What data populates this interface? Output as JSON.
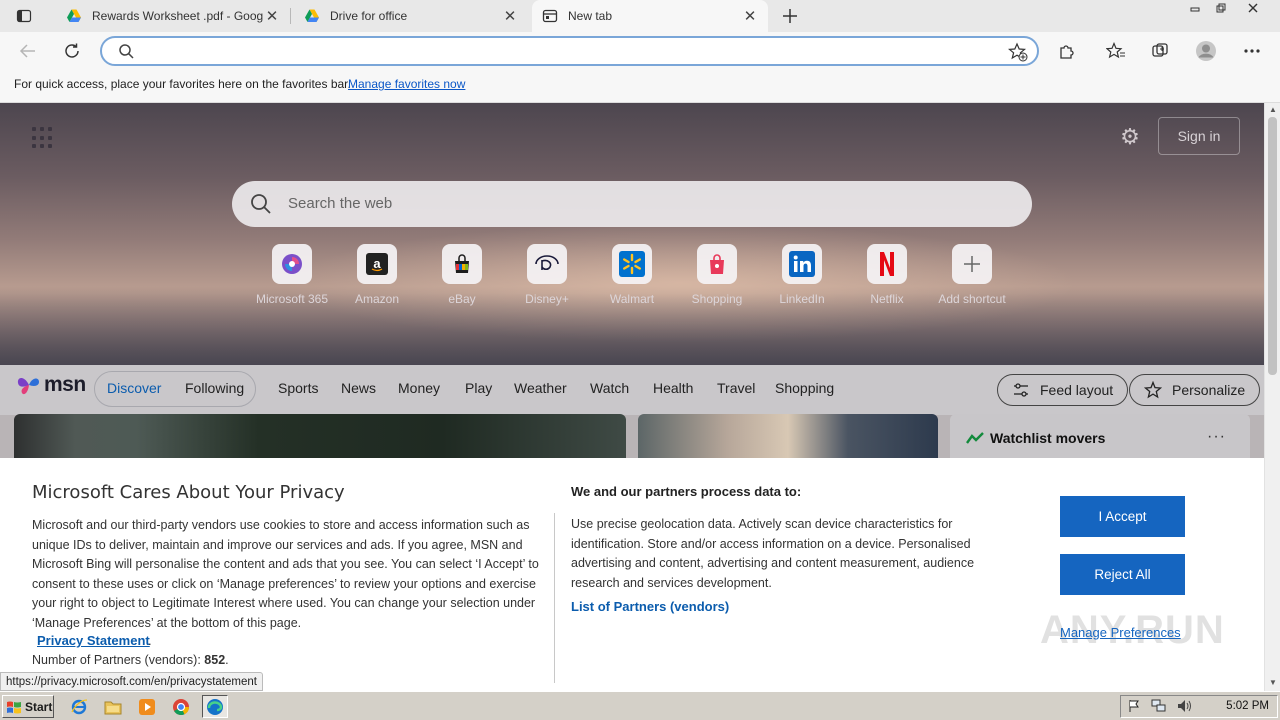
{
  "browser": {
    "tabs": [
      {
        "title": "Rewards Worksheet .pdf - Goog",
        "icon": "google-drive-icon"
      },
      {
        "title": "Drive for office",
        "icon": "google-drive-icon"
      },
      {
        "title": "New tab",
        "icon": "new-tab-icon"
      }
    ],
    "address_value": "",
    "favorites_bar": {
      "message": "For quick access, place your favorites here on the favorites bar.",
      "link": "Manage favorites now"
    }
  },
  "newtab": {
    "signin": "Sign in",
    "search_placeholder": "Search the web",
    "shortcuts": [
      {
        "label": "Microsoft 365",
        "icon": "microsoft365-icon"
      },
      {
        "label": "Amazon",
        "icon": "amazon-icon"
      },
      {
        "label": "eBay",
        "icon": "ebay-icon"
      },
      {
        "label": "Disney+",
        "icon": "disney-plus-icon"
      },
      {
        "label": "Walmart",
        "icon": "walmart-icon"
      },
      {
        "label": "Shopping",
        "icon": "shopping-bag-icon"
      },
      {
        "label": "LinkedIn",
        "icon": "linkedin-icon"
      },
      {
        "label": "Netflix",
        "icon": "netflix-icon"
      },
      {
        "label": "Add shortcut",
        "icon": "plus-icon"
      }
    ]
  },
  "msn": {
    "logo": "msn",
    "tabs": [
      "Discover",
      "Following"
    ],
    "nav": [
      "Sports",
      "News",
      "Money",
      "Play",
      "Weather",
      "Watch",
      "Health",
      "Travel",
      "Shopping"
    ],
    "feed_layout": "Feed layout",
    "personalize": "Personalize",
    "watchlist_title": "Watchlist movers",
    "more": "···"
  },
  "privacy": {
    "title": "Microsoft Cares About Your Privacy",
    "body": "Microsoft and our third-party vendors use cookies to store and access information such as unique IDs to deliver, maintain and improve our services and ads. If you agree, MSN and Microsoft Bing will personalise the content and ads that you see. You can select ‘I Accept’ to consent to these uses or click on ‘Manage preferences’ to review your options and exercise your right to object to Legitimate Interest where used.  You can change your selection under ‘Manage Preferences’ at the bottom of this page.",
    "privacy_link": "Privacy Statement",
    "partners_label": "Number of Partners (vendors):",
    "partners_count": "852",
    "partners_heading": "We and our partners process data to:",
    "purposes": "Use precise geolocation data. Actively scan device characteristics for identification. Store and/or access information on a device. Personalised advertising and content, advertising and content measurement, audience research and services development.",
    "list_link": "List of Partners (vendors)",
    "accept": "I Accept",
    "reject": "Reject All",
    "manage": "Manage Preferences"
  },
  "status_url": "https://privacy.microsoft.com/en/privacystatement",
  "watermark": "ANY.RUN",
  "taskbar": {
    "start": "Start",
    "apps": [
      "internet-explorer-icon",
      "file-explorer-icon",
      "media-player-icon",
      "chrome-icon",
      "edge-icon"
    ],
    "clock": "5:02 PM"
  },
  "colors": {
    "accent": "#1565c0",
    "link": "#0b5cad"
  }
}
